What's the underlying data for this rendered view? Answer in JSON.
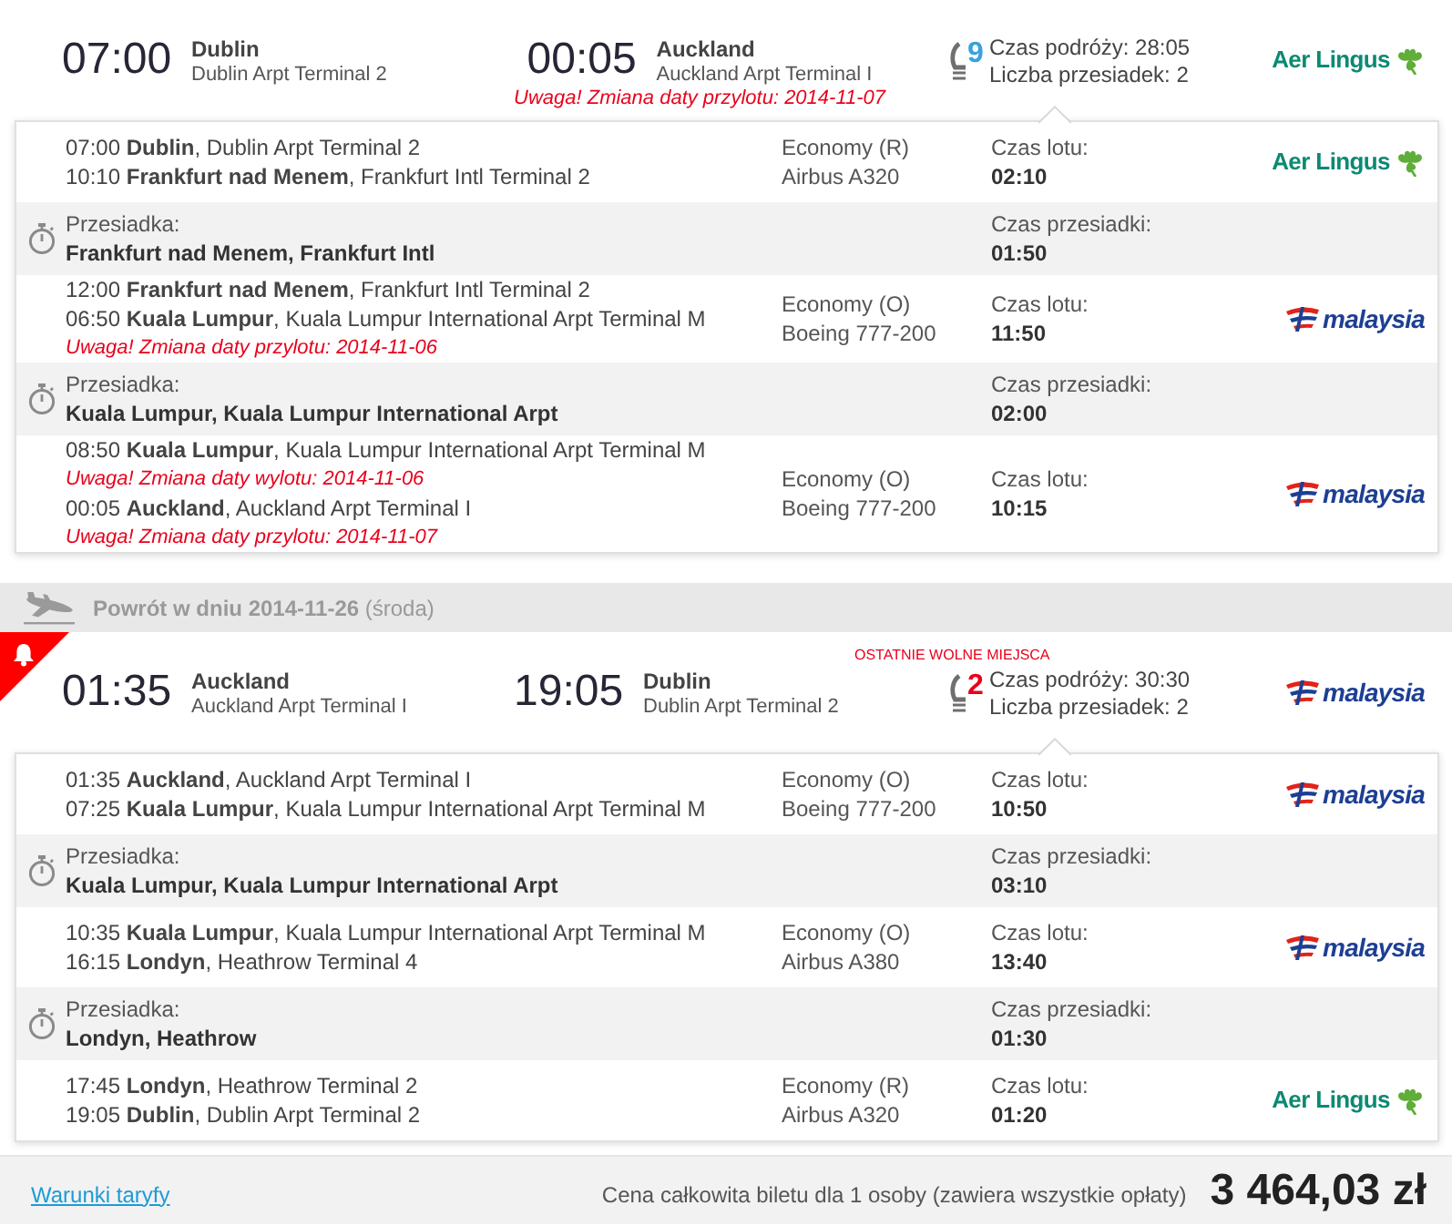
{
  "journeys": [
    {
      "header": {
        "depart_time": "07:00",
        "depart_city": "Dublin",
        "depart_airport": "Dublin Arpt Terminal 2",
        "arrive_time": "00:05",
        "arrive_city": "Auckland",
        "arrive_airport": "Auckland Arpt Terminal I",
        "arrive_warning": "Uwaga! Zmiana daty przylotu: 2014-11-07",
        "last_seats": false,
        "seats": "9",
        "travel_time": "Czas podróży: 28:05",
        "stops": "Liczba przesiadek: 2",
        "airline": {
          "kind": "aer_lingus",
          "name": "Aer Lingus"
        }
      },
      "segments": [
        {
          "kind": "flight",
          "lines": [
            {
              "kind": "stop",
              "text": "07:00 **Dublin**, Dublin Arpt Terminal 2"
            },
            {
              "kind": "stop",
              "text": "10:10 **Frankfurt nad Menem**, Frankfurt Intl Terminal 2"
            }
          ],
          "cabin": "Economy (R)",
          "aircraft": "Airbus A320",
          "time_label": "Czas lotu:",
          "time": "02:10",
          "airline": {
            "kind": "aer_lingus",
            "name": "Aer Lingus"
          }
        },
        {
          "kind": "layover",
          "label": "Przesiadka:",
          "place": "Frankfurt nad Menem, Frankfurt Intl",
          "time_label": "Czas przesiadki:",
          "time": "01:50"
        },
        {
          "kind": "flight",
          "lines": [
            {
              "kind": "stop",
              "text": "12:00 **Frankfurt nad Menem**, Frankfurt Intl Terminal 2"
            },
            {
              "kind": "stop",
              "text": "06:50 **Kuala Lumpur**, Kuala Lumpur International Arpt Terminal M"
            },
            {
              "kind": "warning",
              "text": "Uwaga! Zmiana daty przylotu: 2014-11-06"
            }
          ],
          "cabin": "Economy (O)",
          "aircraft": "Boeing 777-200",
          "time_label": "Czas lotu:",
          "time": "11:50",
          "airline": {
            "kind": "malaysia",
            "name": "malaysia"
          }
        },
        {
          "kind": "layover",
          "label": "Przesiadka:",
          "place": "Kuala Lumpur, Kuala Lumpur International Arpt",
          "time_label": "Czas przesiadki:",
          "time": "02:00"
        },
        {
          "kind": "flight",
          "lines": [
            {
              "kind": "stop",
              "text": "08:50 **Kuala Lumpur**, Kuala Lumpur International Arpt Terminal M"
            },
            {
              "kind": "warning",
              "text": "Uwaga! Zmiana daty wylotu: 2014-11-06"
            },
            {
              "kind": "stop",
              "text": "00:05 **Auckland**, Auckland Arpt Terminal I"
            },
            {
              "kind": "warning",
              "text": "Uwaga! Zmiana daty przylotu: 2014-11-07"
            }
          ],
          "cabin": "Economy (O)",
          "aircraft": "Boeing 777-200",
          "time_label": "Czas lotu:",
          "time": "10:15",
          "airline": {
            "kind": "malaysia",
            "name": "malaysia"
          }
        }
      ]
    },
    {
      "date_bar": "**Powrót w dniu 2014-11-26** (środa)",
      "header": {
        "depart_time": "01:35",
        "depart_city": "Auckland",
        "depart_airport": "Auckland Arpt Terminal I",
        "arrive_time": "19:05",
        "arrive_city": "Dublin",
        "arrive_airport": "Dublin Arpt Terminal 2",
        "last_seats": true,
        "notice": "OSTATNIE WOLNE MIEJSCA",
        "seats": "2",
        "travel_time": "Czas podróży: 30:30",
        "stops": "Liczba przesiadek: 2",
        "airline": {
          "kind": "malaysia",
          "name": "malaysia"
        }
      },
      "segments": [
        {
          "kind": "flight",
          "lines": [
            {
              "kind": "stop",
              "text": "01:35 **Auckland**, Auckland Arpt Terminal I"
            },
            {
              "kind": "stop",
              "text": "07:25 **Kuala Lumpur**, Kuala Lumpur International Arpt Terminal M"
            }
          ],
          "cabin": "Economy (O)",
          "aircraft": "Boeing 777-200",
          "time_label": "Czas lotu:",
          "time": "10:50",
          "airline": {
            "kind": "malaysia",
            "name": "malaysia"
          }
        },
        {
          "kind": "layover",
          "label": "Przesiadka:",
          "place": "Kuala Lumpur, Kuala Lumpur International Arpt",
          "time_label": "Czas przesiadki:",
          "time": "03:10"
        },
        {
          "kind": "flight",
          "lines": [
            {
              "kind": "stop",
              "text": "10:35 **Kuala Lumpur**, Kuala Lumpur International Arpt Terminal M"
            },
            {
              "kind": "stop",
              "text": "16:15 **Londyn**, Heathrow Terminal 4"
            }
          ],
          "cabin": "Economy (O)",
          "aircraft": "Airbus A380",
          "time_label": "Czas lotu:",
          "time": "13:40",
          "airline": {
            "kind": "malaysia",
            "name": "malaysia"
          }
        },
        {
          "kind": "layover",
          "label": "Przesiadka:",
          "place": "Londyn, Heathrow",
          "time_label": "Czas przesiadki:",
          "time": "01:30"
        },
        {
          "kind": "flight",
          "lines": [
            {
              "kind": "stop",
              "text": "17:45 **Londyn**, Heathrow Terminal 2"
            },
            {
              "kind": "stop",
              "text": "19:05 **Dublin**, Dublin Arpt Terminal 2"
            }
          ],
          "cabin": "Economy (R)",
          "aircraft": "Airbus A320",
          "time_label": "Czas lotu:",
          "time": "01:20",
          "airline": {
            "kind": "aer_lingus",
            "name": "Aer Lingus"
          }
        }
      ]
    }
  ],
  "footer": {
    "link": "Warunki taryfy",
    "price_label": "Cena całkowita biletu dla 1 osoby (zawiera wszystkie opłaty)",
    "price": "3 464,03 zł"
  }
}
